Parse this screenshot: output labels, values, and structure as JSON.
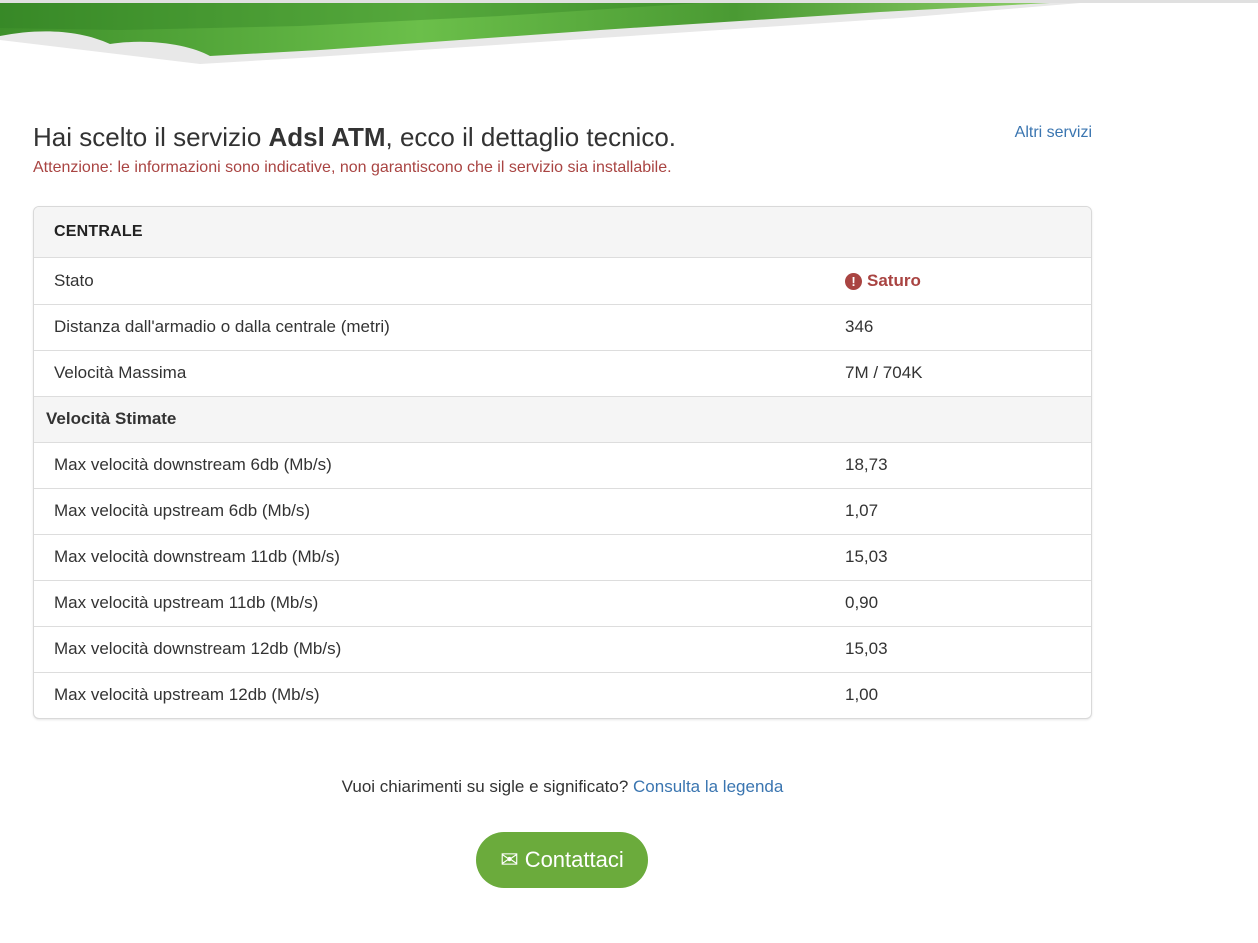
{
  "header": {
    "accent": "#5aa83a"
  },
  "intro": {
    "title_prefix": "Hai scelto il servizio ",
    "service_name": "Adsl ATM",
    "title_suffix": ", ecco il dettaglio tecnico.",
    "warning": "Attenzione: le informazioni sono indicative, non garantiscono che il servizio sia installabile.",
    "other_services_link": "Altri servizi"
  },
  "panel": {
    "heading": "CENTRALE",
    "rows": [
      {
        "label": "Stato",
        "value": "Saturo",
        "icon": "exclamation-circle-icon",
        "status_color": "#a94442"
      },
      {
        "label": "Distanza dall'armadio o dalla centrale (metri)",
        "value": "346"
      },
      {
        "label": "Velocità Massima",
        "value": "7M / 704K"
      }
    ],
    "section_label": "Velocità Stimate",
    "estimates": [
      {
        "label": "Max velocità downstream 6db (Mb/s)",
        "value": "18,73"
      },
      {
        "label": "Max velocità upstream 6db (Mb/s)",
        "value": "1,07"
      },
      {
        "label": "Max velocità downstream 11db (Mb/s)",
        "value": "15,03"
      },
      {
        "label": "Max velocità upstream 11db (Mb/s)",
        "value": "0,90"
      },
      {
        "label": "Max velocità downstream 12db (Mb/s)",
        "value": "15,03"
      },
      {
        "label": "Max velocità upstream 12db (Mb/s)",
        "value": "1,00"
      }
    ]
  },
  "help": {
    "question": "Vuoi chiarimenti su sigle e significato? ",
    "legend_link": "Consulta la legenda"
  },
  "contact": {
    "label": "Contattaci",
    "icon": "envelope-icon",
    "color": "#6bab3c"
  }
}
